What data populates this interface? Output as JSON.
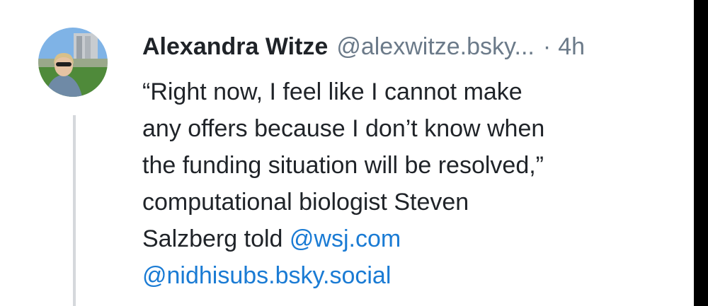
{
  "post": {
    "author": {
      "display_name": "Alexandra Witze",
      "handle": "@alexwitze.bsky...",
      "avatar_icon": "profile-photo"
    },
    "separator": "·",
    "timestamp": "4h",
    "body": {
      "line1": "“Right now, I feel like I cannot make",
      "line2": "any offers because I don’t know when",
      "line3": "the funding situation will be resolved,”",
      "line4": "computational biologist Steven",
      "line5_text": "Salzberg told",
      "mention1": "@wsj.com",
      "mention2": "@nidhisubs.bsky.social"
    },
    "colors": {
      "text": "#1f2328",
      "muted": "#6b7a89",
      "link": "#1a7bd4",
      "thread_line": "#d5d8dc"
    }
  }
}
